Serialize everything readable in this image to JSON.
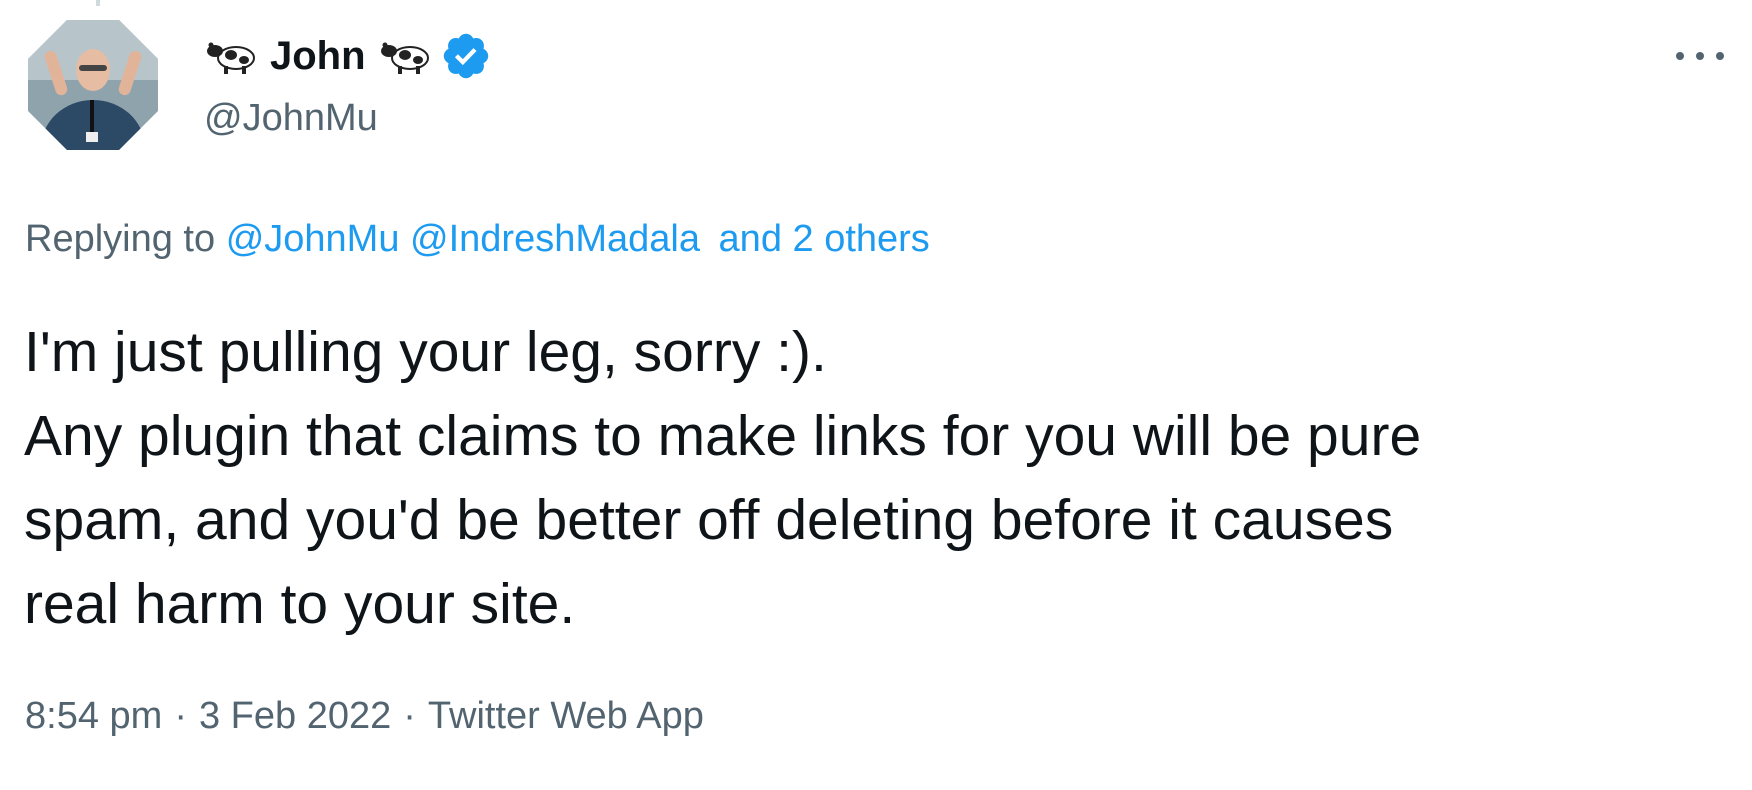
{
  "tweet": {
    "author": {
      "display_name": "John",
      "name_emoji_left": "cow-icon",
      "name_emoji_right": "cow-icon",
      "handle": "@JohnMu",
      "verified_icon": "verified-badge-icon",
      "avatar_icon": "avatar-photo"
    },
    "more_icon": "more-options-icon",
    "reply_context": {
      "prefix": "Replying to",
      "mentions": [
        "@JohnMu",
        "@IndreshMadala"
      ],
      "others": "and 2 others"
    },
    "text_lines": [
      "I'm just pulling your leg, sorry :).",
      "Any plugin that claims to make links for you will be pure",
      "spam, and you'd be better off deleting before it causes",
      "real harm to your site."
    ],
    "meta": {
      "time": "8:54 pm",
      "separator": "·",
      "date": "3 Feb 2022",
      "source": "Twitter Web App"
    }
  },
  "colors": {
    "link": "#1d9bf0",
    "secondary_text": "#536471",
    "primary_text": "#0f1419",
    "verified": "#1d9bf0"
  }
}
